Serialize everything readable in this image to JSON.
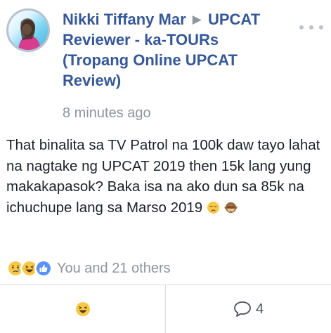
{
  "post": {
    "author": "Nikki Tiffany Mar",
    "group": "UPCAT Reviewer - ka-TOURs (Tropang Online UPCAT Review)",
    "timestamp": "8 minutes ago",
    "body": "That binalita sa TV Patrol na 100k daw tayo lahat na nagtake ng UPCAT 2019 then 15k lang yung makakapasok? Baka isa na ako dun sa 85k na ichuchupe lang sa Marso 2019",
    "body_emojis": [
      "disappointed-face",
      "see-no-evil-monkey"
    ],
    "reactions": {
      "icons": [
        "sad-reaction-icon",
        "haha-reaction-icon",
        "like-reaction-icon"
      ],
      "summary": "You and 21 others"
    },
    "actions": {
      "reaction_icon": "haha-reaction-icon",
      "comment_icon": "comment-icon",
      "comment_count": "4"
    }
  },
  "colors": {
    "name_link": "#365899",
    "meta_gray": "#90949c",
    "text": "#1d2129",
    "like_blue": "#5890ff",
    "emoji_yellow": "#f7c948"
  }
}
